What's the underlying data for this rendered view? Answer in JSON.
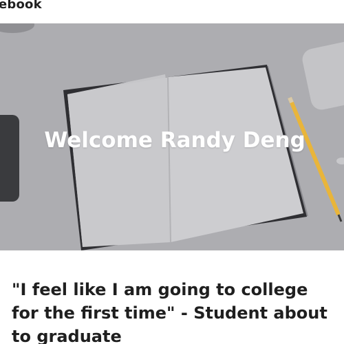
{
  "site": {
    "brand_name": "ebook"
  },
  "hero": {
    "heading": "Welcome Randy Deng"
  },
  "post": {
    "title": "\"I feel like I am going to college for the first time\" - Student about to graduate"
  },
  "colors": {
    "hero_overlay": "#a9a9ad",
    "text_dark": "#1f1f1f",
    "hero_text": "#ffffff",
    "pencil_yellow": "#e9b53a"
  }
}
